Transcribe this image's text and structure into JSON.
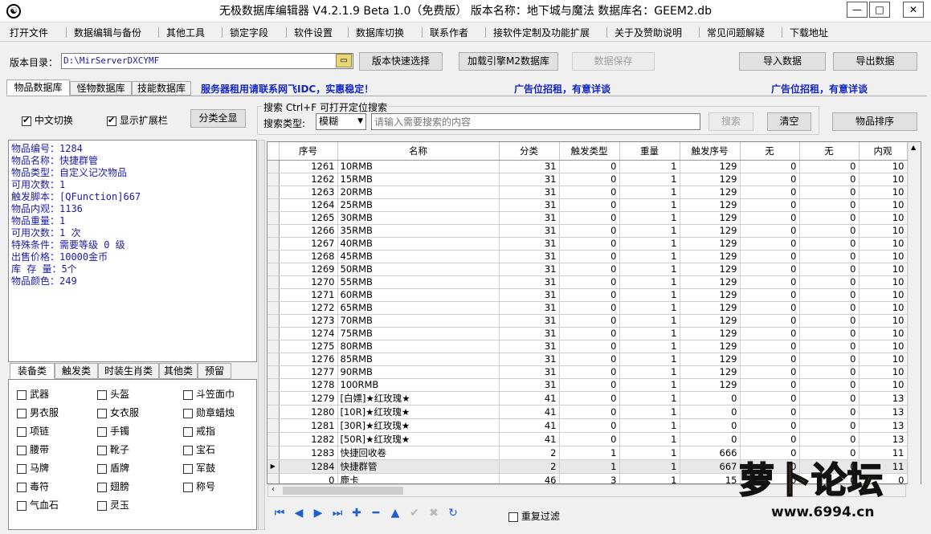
{
  "window": {
    "title": "无极数据库编辑器 V4.2.1.9  Beta 1.0（免费版）   版本名称：地下城与魔法    数据库名：GEEM2.db",
    "app_icon": "yin-yang-icon",
    "min": "—",
    "max": "□",
    "close": "✕"
  },
  "menu": [
    "打开文件",
    "数据编辑与备份",
    "其他工具",
    "锁定字段",
    "软件设置",
    "数据库切换",
    "联系作者",
    "接软件定制及功能扩展",
    "关于及赞助说明",
    "常见问题解疑",
    "下载地址"
  ],
  "toolbar": {
    "dir_label": "版本目录：",
    "dir_value": "D:\\MirServerDXCYMF",
    "quick_select": "版本快速选择",
    "load_engine": "加载引擎M2数据库",
    "save": "数据保存",
    "import": "导入数据",
    "export": "导出数据"
  },
  "tabs": [
    "物品数据库",
    "怪物数据库",
    "技能数据库"
  ],
  "ads": {
    "a1": "服务器租用请联系网飞IDC，实惠稳定！",
    "a2": "广告位招租，有意详谈",
    "a3": "广告位招租，有意详谈"
  },
  "options": {
    "chinese": "中文切换",
    "ext": "显示扩展栏",
    "show_all": "分类全显"
  },
  "search": {
    "title": "搜索  Ctrl+F 可打开定位搜索",
    "type_label": "搜索类型:",
    "type_value": "模糊",
    "placeholder": "请输入需要搜索的内容",
    "btn": "搜索",
    "clear": "清空",
    "sort": "物品排序"
  },
  "info": [
    "物品编号：1284",
    "物品名称：快捷群管",
    "物品类型：自定义记次物品",
    "可用次数：1",
    "触发脚本：[QFunction]667",
    "物品内观：1136",
    "物品重量：1",
    "可用次数：1 次",
    "特殊条件：需要等级 0 级",
    "出售价格：10000金币",
    "库 存 量：5个",
    "物品颜色：249"
  ],
  "cat_tabs": [
    "装备类",
    "触发类",
    "时装生肖类",
    "其他类",
    "预留"
  ],
  "categories": [
    [
      "武器",
      "头盔",
      "斗笠面巾"
    ],
    [
      "男衣服",
      "女衣服",
      "勋章蜡烛"
    ],
    [
      "项链",
      "手镯",
      "戒指"
    ],
    [
      "腰带",
      "靴子",
      "宝石"
    ],
    [
      "马牌",
      "盾牌",
      "军鼓"
    ],
    [
      "毒符",
      "翅膀",
      "称号"
    ],
    [
      "气血石",
      "灵玉",
      ""
    ]
  ],
  "grid": {
    "columns": [
      "序号",
      "名称",
      "分类",
      "触发类型",
      "重量",
      "触发序号",
      "无",
      "无",
      "内观"
    ],
    "rows": [
      [
        "1261",
        "10RMB",
        "31",
        "0",
        "1",
        "129",
        "0",
        "0",
        "10"
      ],
      [
        "1262",
        "15RMB",
        "31",
        "0",
        "1",
        "129",
        "0",
        "0",
        "10"
      ],
      [
        "1263",
        "20RMB",
        "31",
        "0",
        "1",
        "129",
        "0",
        "0",
        "10"
      ],
      [
        "1264",
        "25RMB",
        "31",
        "0",
        "1",
        "129",
        "0",
        "0",
        "10"
      ],
      [
        "1265",
        "30RMB",
        "31",
        "0",
        "1",
        "129",
        "0",
        "0",
        "10"
      ],
      [
        "1266",
        "35RMB",
        "31",
        "0",
        "1",
        "129",
        "0",
        "0",
        "10"
      ],
      [
        "1267",
        "40RMB",
        "31",
        "0",
        "1",
        "129",
        "0",
        "0",
        "10"
      ],
      [
        "1268",
        "45RMB",
        "31",
        "0",
        "1",
        "129",
        "0",
        "0",
        "10"
      ],
      [
        "1269",
        "50RMB",
        "31",
        "0",
        "1",
        "129",
        "0",
        "0",
        "10"
      ],
      [
        "1270",
        "55RMB",
        "31",
        "0",
        "1",
        "129",
        "0",
        "0",
        "10"
      ],
      [
        "1271",
        "60RMB",
        "31",
        "0",
        "1",
        "129",
        "0",
        "0",
        "10"
      ],
      [
        "1272",
        "65RMB",
        "31",
        "0",
        "1",
        "129",
        "0",
        "0",
        "10"
      ],
      [
        "1273",
        "70RMB",
        "31",
        "0",
        "1",
        "129",
        "0",
        "0",
        "10"
      ],
      [
        "1274",
        "75RMB",
        "31",
        "0",
        "1",
        "129",
        "0",
        "0",
        "10"
      ],
      [
        "1275",
        "80RMB",
        "31",
        "0",
        "1",
        "129",
        "0",
        "0",
        "10"
      ],
      [
        "1276",
        "85RMB",
        "31",
        "0",
        "1",
        "129",
        "0",
        "0",
        "10"
      ],
      [
        "1277",
        "90RMB",
        "31",
        "0",
        "1",
        "129",
        "0",
        "0",
        "10"
      ],
      [
        "1278",
        "100RMB",
        "31",
        "0",
        "1",
        "129",
        "0",
        "0",
        "10"
      ],
      [
        "1279",
        "[白嫖]★红玫瑰★",
        "41",
        "0",
        "1",
        "0",
        "0",
        "0",
        "13"
      ],
      [
        "1280",
        "[10R]★红玫瑰★",
        "41",
        "0",
        "1",
        "0",
        "0",
        "0",
        "13"
      ],
      [
        "1281",
        "[30R]★红玫瑰★",
        "41",
        "0",
        "1",
        "0",
        "0",
        "0",
        "13"
      ],
      [
        "1282",
        "[50R]★红玫瑰★",
        "41",
        "0",
        "1",
        "0",
        "0",
        "0",
        "13"
      ],
      [
        "1283",
        "快捷回收卷",
        "2",
        "1",
        "1",
        "666",
        "0",
        "0",
        "11"
      ],
      [
        "1284",
        "快捷群管",
        "2",
        "1",
        "1",
        "667",
        "0",
        "0",
        "11"
      ],
      [
        "0",
        "鹿卡",
        "46",
        "3",
        "1",
        "15",
        "0",
        "0",
        "0"
      ]
    ],
    "selected_index": 23
  },
  "nav_icons": [
    "first-icon",
    "prev-icon",
    "next-icon",
    "last-icon",
    "add-icon",
    "delete-icon",
    "up-icon",
    "confirm-icon",
    "cancel-icon",
    "refresh-icon"
  ],
  "dup_filter": "重复过滤",
  "watermark": {
    "text": "萝卜论坛",
    "url": "www.6994.cn"
  }
}
